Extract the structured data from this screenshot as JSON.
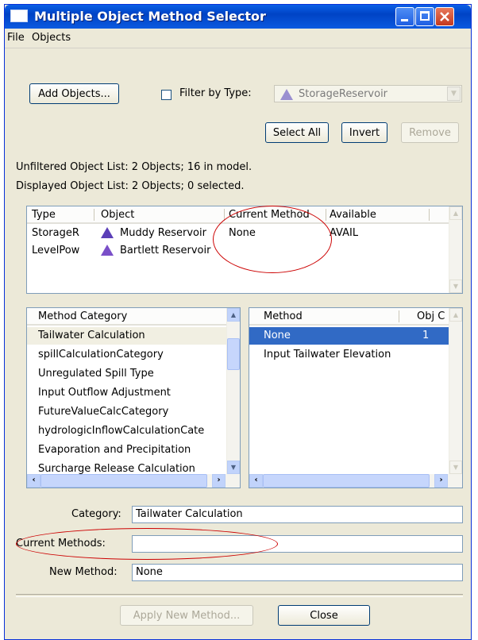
{
  "window": {
    "title": "Multiple Object Method Selector"
  },
  "menu": {
    "items": [
      "File",
      "Objects"
    ]
  },
  "toolbar": {
    "add_objects": "Add Objects...",
    "filter_label": "Filter by Type:",
    "filter_value": "StorageReservoir",
    "select_all": "Select All",
    "invert": "Invert",
    "remove": "Remove"
  },
  "status": {
    "unfiltered": "Unfiltered Object List:  2 Objects;  16 in model.",
    "displayed": "Displayed Object List:  2 Objects;  0 selected."
  },
  "object_table": {
    "headers": [
      "Type",
      "Object",
      "Current Method",
      "Available"
    ],
    "rows": [
      {
        "type": "StorageR",
        "object": "Muddy Reservoir",
        "current_method": "None",
        "available": "AVAIL"
      },
      {
        "type": "LevelPow",
        "object": "Bartlett Reservoir",
        "current_method": "",
        "available": ""
      }
    ]
  },
  "category_list": {
    "header": "Method Category",
    "items": [
      "Tailwater Calculation",
      "spillCalculationCategory",
      "Unregulated Spill Type",
      "Input Outflow Adjustment",
      "FutureValueCalcCategory",
      "hydrologicInflowCalculationCate",
      "Evaporation and Precipitation",
      "Surcharge Release Calculation"
    ],
    "selected_index": 0
  },
  "method_list": {
    "headers": [
      "Method",
      "Obj C"
    ],
    "rows": [
      {
        "method": "None",
        "count": "1"
      },
      {
        "method": "Input Tailwater Elevation",
        "count": ""
      }
    ],
    "selected_index": 0
  },
  "form": {
    "category_label": "Category:",
    "category_value": "Tailwater Calculation",
    "current_methods_label": "Current Methods:",
    "current_methods_value": "",
    "new_method_label": "New Method:",
    "new_method_value": "None"
  },
  "footer": {
    "apply": "Apply New Method...",
    "close": "Close"
  },
  "colors": {
    "title_bar": "#0054e3",
    "selection": "#316ac5",
    "annotation": "#cc0000",
    "dialog_bg": "#ece9d8"
  },
  "icons": {
    "object_type": "purple-triangle-icon"
  }
}
